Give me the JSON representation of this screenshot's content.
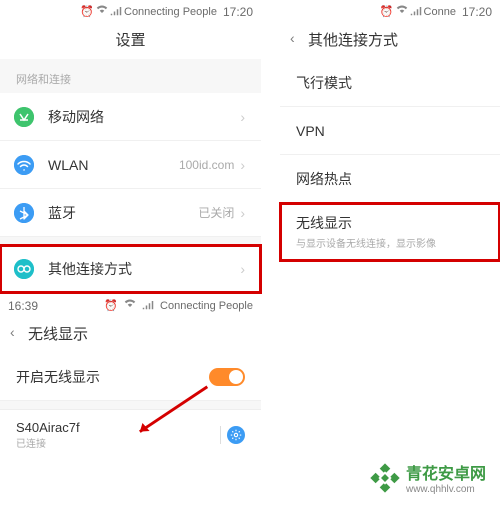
{
  "left": {
    "status": {
      "label": "Connecting People",
      "time": "17:20"
    },
    "settings_title": "设置",
    "section_net": "网络和连接",
    "rows": {
      "mobile": {
        "label": "移动网络"
      },
      "wlan": {
        "label": "WLAN",
        "value": "100id.com"
      },
      "bt": {
        "label": "蓝牙",
        "value": "已关闭"
      },
      "other": {
        "label": "其他连接方式"
      }
    },
    "p3": {
      "status": {
        "label": "Connecting People",
        "time": "16:39"
      },
      "title": "无线显示",
      "enable_label": "开启无线显示",
      "device": {
        "name": "S40Airac7f",
        "sub": "已连接"
      }
    }
  },
  "right": {
    "status": {
      "label": "Conne",
      "time": "17:20"
    },
    "title": "其他连接方式",
    "rows": {
      "airplane": "飞行模式",
      "vpn": "VPN",
      "hotspot": "网络热点",
      "cast": "无线显示",
      "cast_sub": "与显示设备无线连接，显示影像"
    }
  },
  "wm": {
    "title": "青花安卓网",
    "url": "www.qhhlv.com"
  }
}
